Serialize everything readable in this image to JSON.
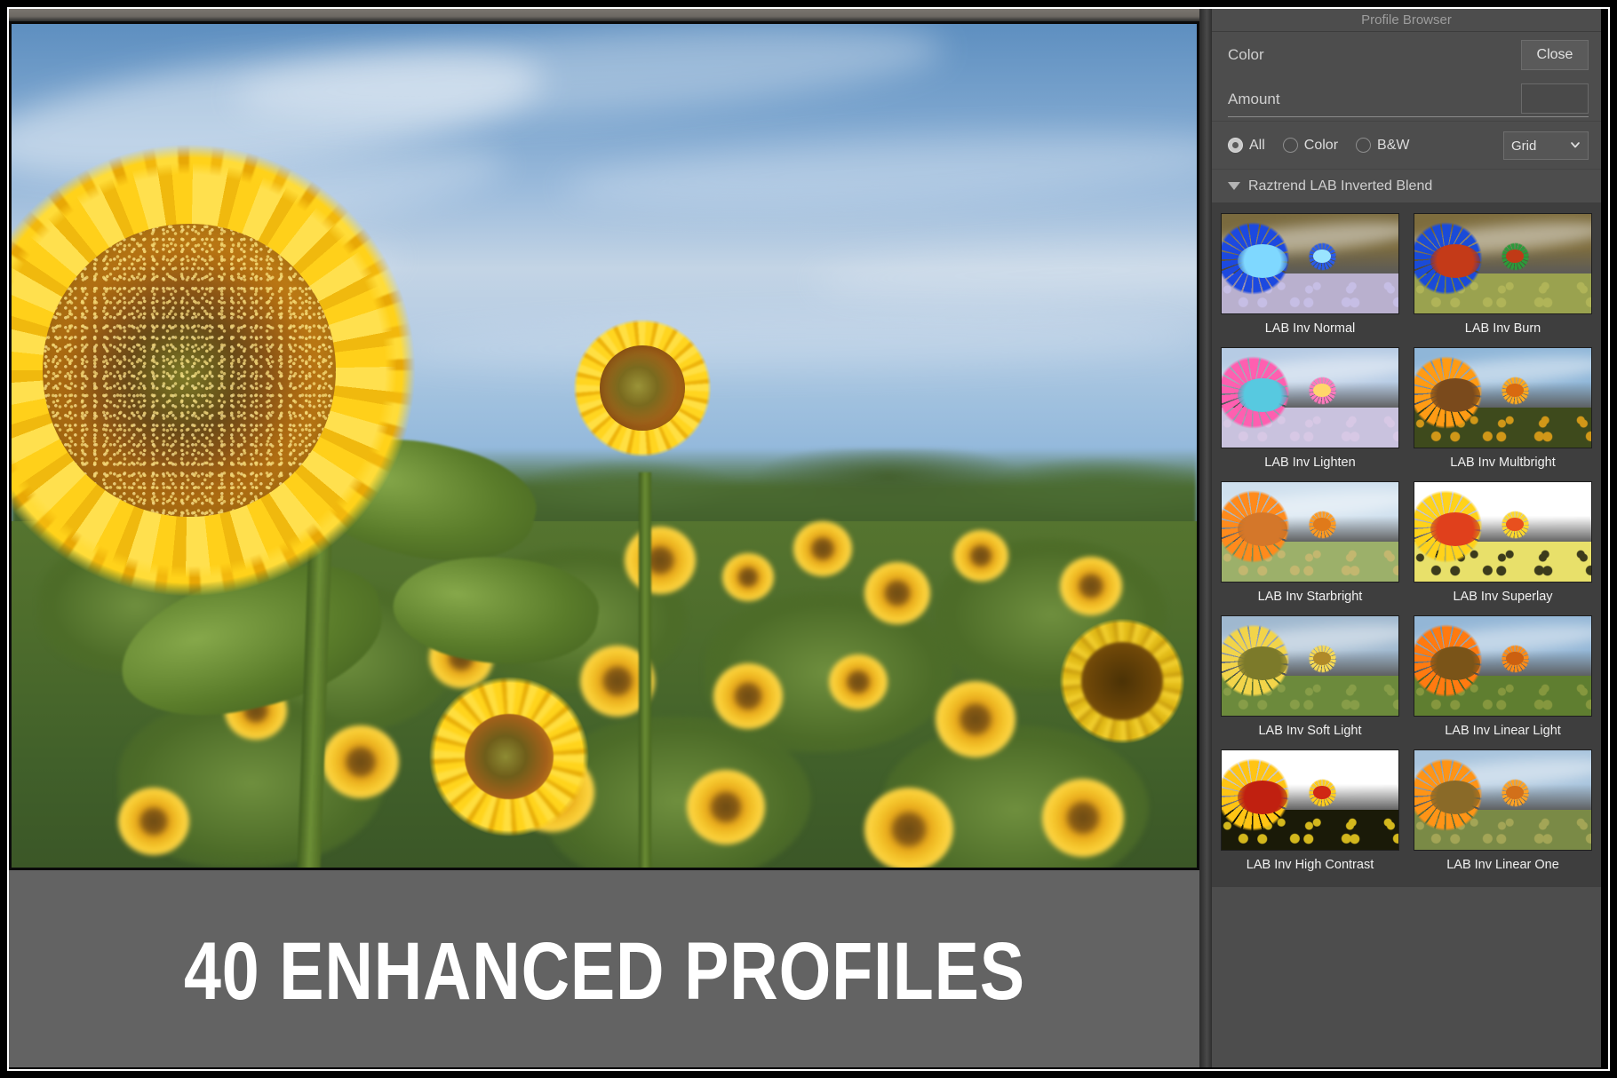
{
  "banner": {
    "headline": "40 ENHANCED PROFILES"
  },
  "panel": {
    "title": "Profile Browser",
    "color_row": {
      "label": "Color",
      "close_label": "Close"
    },
    "amount_row": {
      "label": "Amount",
      "value": ""
    },
    "filters": {
      "options": [
        {
          "label": "All",
          "selected": true
        },
        {
          "label": "Color",
          "selected": false
        },
        {
          "label": "B&W",
          "selected": false
        }
      ],
      "view_mode": "Grid",
      "chevron_icon": "chevron-down-icon"
    },
    "group": {
      "expanded": true,
      "disclosure_icon": "triangle-down-icon",
      "name": "Raztrend LAB Inverted Blend"
    },
    "profiles": [
      {
        "label": "LAB Inv Normal",
        "sky": "#7a6a3e",
        "ground": "#b9b0ce",
        "petal": "#1c49e0",
        "core": "#7fd8ff",
        "flower2": "#2a5ce8",
        "flower2core": "#9ae4ff",
        "speck": "#c8c0e8"
      },
      {
        "label": "LAB Inv Burn",
        "sky": "#7d6c3d",
        "ground": "#9aa24f",
        "petal": "#1a4bd8",
        "core": "#c43a18",
        "flower2": "#2c9a3a",
        "flower2core": "#c03a16",
        "speck": "#b3b65a"
      },
      {
        "label": "LAB Inv Lighten",
        "sky": "#b6cbe4",
        "ground": "#c9c2de",
        "petal": "#ff5fb0",
        "core": "#57c9e0",
        "flower2": "#ff79bd",
        "flower2core": "#ffd66a",
        "speck": "#d9c9e6"
      },
      {
        "label": "LAB Inv Multbright",
        "sky": "#8fb6d8",
        "ground": "#3e4a1c",
        "petal": "#ff9b14",
        "core": "#7a4a1c",
        "flower2": "#ffa91e",
        "flower2core": "#d86a10",
        "speck": "#e0a018"
      },
      {
        "label": "LAB Inv Starbright",
        "sky": "#cfe0ee",
        "ground": "#9cb06a",
        "petal": "#ff8a1c",
        "core": "#d4772a",
        "flower2": "#ff9a22",
        "flower2core": "#e07a1a",
        "speck": "#c8b870"
      },
      {
        "label": "LAB Inv Superlay",
        "sky": "#ffffff",
        "ground": "#e8e06a",
        "petal": "#ffd21a",
        "core": "#e0401c",
        "flower2": "#ffd82c",
        "flower2core": "#e8501e",
        "speck": "#2a2a14"
      },
      {
        "label": "LAB Inv Soft Light",
        "sky": "#9fb8cf",
        "ground": "#6c8a3c",
        "petal": "#f2d44a",
        "core": "#7c7a2a",
        "flower2": "#f6d954",
        "flower2core": "#b08a28",
        "speck": "#8aa04a"
      },
      {
        "label": "LAB Inv Linear Light",
        "sky": "#93b6d6",
        "ground": "#5f7e30",
        "petal": "#ff7a10",
        "core": "#7a5418",
        "flower2": "#ff8c18",
        "flower2core": "#cc6010",
        "speck": "#8a9a40"
      },
      {
        "label": "LAB Inv High Contrast",
        "sky": "#ffffff",
        "ground": "#1a1a08",
        "petal": "#ffc414",
        "core": "#c02010",
        "flower2": "#ffcc1c",
        "flower2core": "#d02814",
        "speck": "#e8c820"
      },
      {
        "label": "LAB Inv Linear One",
        "sky": "#a8c4dd",
        "ground": "#7a8a46",
        "petal": "#ff9416",
        "core": "#8a6a28",
        "flower2": "#ffa224",
        "flower2core": "#d2701a",
        "speck": "#a8a858"
      }
    ]
  }
}
